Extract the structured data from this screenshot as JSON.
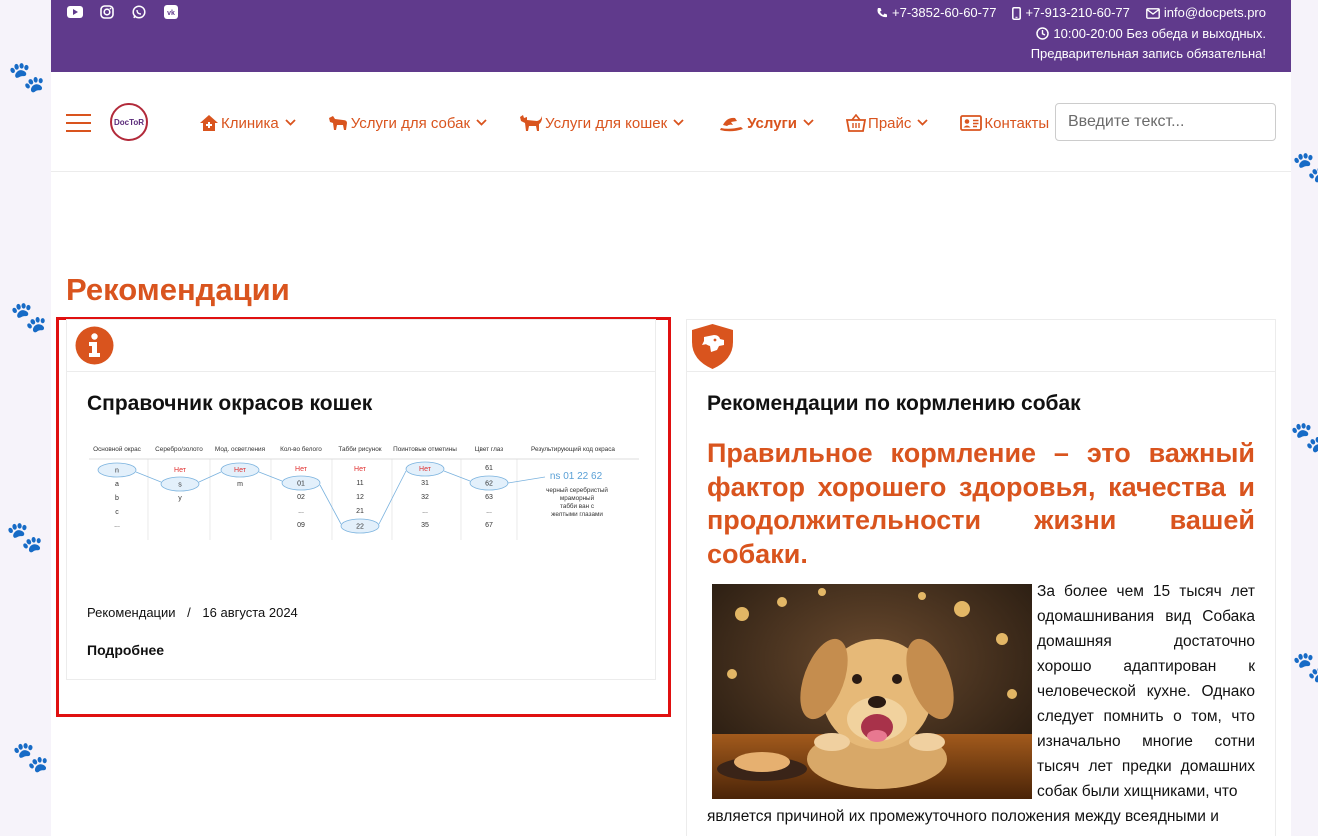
{
  "topbar": {
    "phone1": "+7-3852-60-60-77",
    "phone2": "+7-913-210-60-77",
    "email": "info@docpets.pro",
    "hours": "10:00-20:00 Без обеда и выходных.",
    "notice": "Предварительная запись обязательна!",
    "social_icons": [
      "youtube-icon",
      "instagram-icon",
      "whatsapp-icon",
      "vk-icon"
    ]
  },
  "logo": {
    "text": "DocToR"
  },
  "nav": {
    "items": [
      {
        "label": "Клиника",
        "icon": "clinic-house-icon",
        "dropdown": true
      },
      {
        "label": "Услуги для собак",
        "icon": "dog-icon",
        "dropdown": true
      },
      {
        "label": "Услуги для кошек",
        "icon": "cat-icon",
        "dropdown": true
      },
      {
        "label": "Услуги",
        "icon": "grooming-icon",
        "dropdown": true
      },
      {
        "label": "Прайс",
        "icon": "basket-icon",
        "dropdown": true
      },
      {
        "label": "Контакты",
        "icon": "contact-card-icon",
        "dropdown": false
      }
    ],
    "search_placeholder": "Введите текст..."
  },
  "main": {
    "title": "Рекомендации",
    "card1": {
      "icon": "info-icon",
      "title": "Справочник окрасов кошек",
      "category": "Рекомендации",
      "separator": "/",
      "date": "16 августа 2024",
      "more": "Подробнее",
      "diagram": {
        "headers": [
          "Основной окрас",
          "Серебро/золото",
          "Мод. осветления",
          "Кол-во белого",
          "Табби рисунок",
          "Поинтовые отметины",
          "Цвет глаз",
          "Результирующий код окраса"
        ],
        "col1": [
          "n",
          "a",
          "b",
          "c",
          "..."
        ],
        "col2": [
          "Нет",
          "s",
          "y"
        ],
        "col3": [
          "Нет",
          "m"
        ],
        "col4": [
          "Нет",
          "01",
          "02",
          "...",
          "09"
        ],
        "col5": [
          "Нет",
          "11",
          "12",
          "21",
          "22"
        ],
        "col6": [
          "Нет",
          "31",
          "32",
          "...",
          "35"
        ],
        "col7": [
          "61",
          "62",
          "63",
          "...",
          "67"
        ],
        "result_code": "ns 01 22 62",
        "result_text": [
          "черный серебристый",
          "мраморный",
          "табби ван с",
          "желтыми глазами"
        ]
      }
    },
    "card2": {
      "icon": "dog-shield-icon",
      "title": "Рекомендации по кормлению собак",
      "lead": "Правильное кормление – это важный фактор хорошего здоровья, качества и продолжительности жизни вашей собаки.",
      "body": "За более чем 15 тысяч лет одомашнивания вид Собака домашняя достаточно хорошо адаптирован к человеческой кухне. Однако следует помнить о том, что изначально многие сотни тысяч лет предки домашних собак были хищниками, что",
      "body2": "является причиной их промежуточного положения между всеядными и"
    }
  },
  "colors": {
    "accent": "#d9541e",
    "topbar": "#603a8c",
    "highlight": "#e01010"
  }
}
